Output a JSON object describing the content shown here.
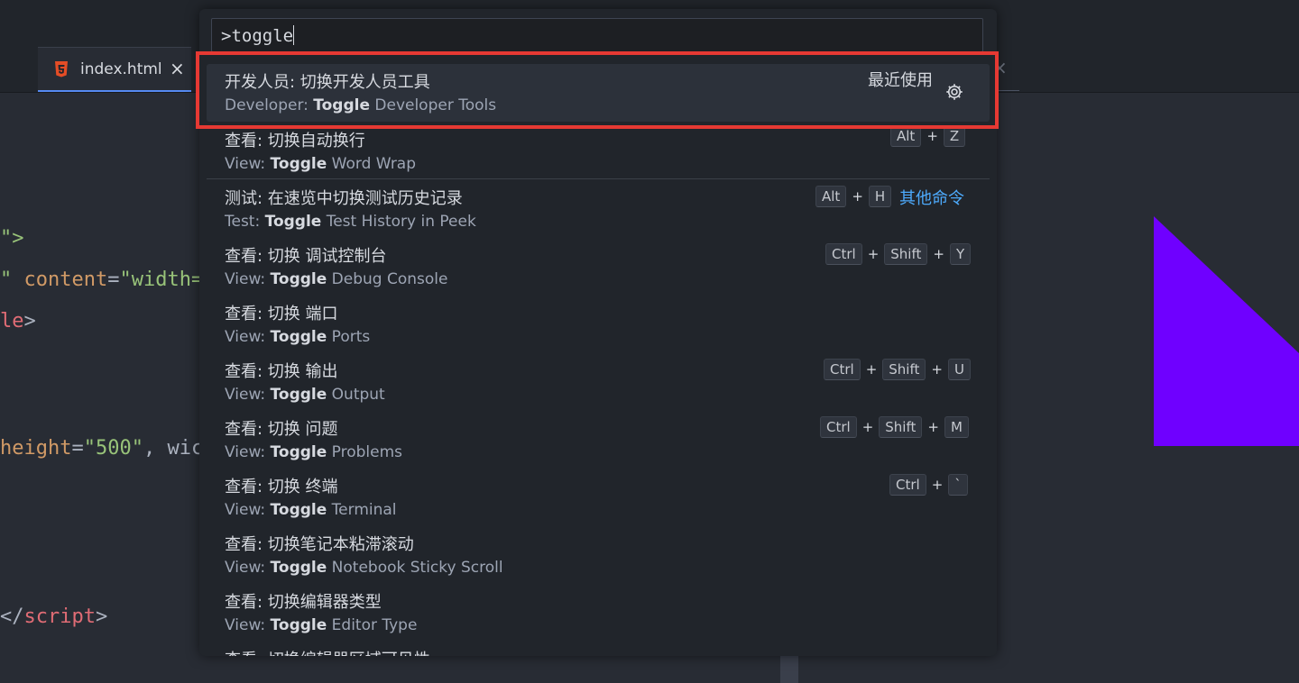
{
  "tab": {
    "label": "index.html",
    "close": "×"
  },
  "tab_bar_close": "×",
  "code_lines": {
    "l1": "\">",
    "l2_str": "\"",
    "l2_attr": " content",
    "l2_eq": "=",
    "l2_val": "\"width=",
    "l3_tag": "le",
    "l3_end": ">",
    "l4_attr": "height",
    "l4_eq": "=",
    "l4_val": "\"500\"",
    "l4_rest": ", wic",
    "l5_open": "</",
    "l5_tag": "script",
    "l5_end": ">"
  },
  "palette": {
    "query": ">toggle",
    "recently_used": "最近使用",
    "other_commands": "其他命令",
    "items": [
      {
        "label": "开发人员: 切换开发人员工具",
        "prefix": "Developer: ",
        "match": "Toggle",
        "suffix": " Developer Tools",
        "keys": []
      },
      {
        "label": "查看: 切换自动换行",
        "prefix": "View: ",
        "match": "Toggle",
        "suffix": " Word Wrap",
        "keys": [
          "Alt",
          "Z"
        ]
      },
      {
        "label": "测试: 在速览中切换测试历史记录",
        "prefix": "Test: ",
        "match": "Toggle",
        "suffix": " Test History in Peek",
        "keys": [
          "Alt",
          "H"
        ]
      },
      {
        "label": "查看: 切换 调试控制台",
        "prefix": "View: ",
        "match": "Toggle",
        "suffix": " Debug Console",
        "keys": [
          "Ctrl",
          "Shift",
          "Y"
        ]
      },
      {
        "label": "查看: 切换 端口",
        "prefix": "View: ",
        "match": "Toggle",
        "suffix": " Ports",
        "keys": []
      },
      {
        "label": "查看: 切换 输出",
        "prefix": "View: ",
        "match": "Toggle",
        "suffix": " Output",
        "keys": [
          "Ctrl",
          "Shift",
          "U"
        ]
      },
      {
        "label": "查看: 切换 问题",
        "prefix": "View: ",
        "match": "Toggle",
        "suffix": " Problems",
        "keys": [
          "Ctrl",
          "Shift",
          "M"
        ]
      },
      {
        "label": "查看: 切换 终端",
        "prefix": "View: ",
        "match": "Toggle",
        "suffix": " Terminal",
        "keys": [
          "Ctrl",
          "`"
        ]
      },
      {
        "label": "查看: 切换笔记本粘滞滚动",
        "prefix": "View: ",
        "match": "Toggle",
        "suffix": " Notebook Sticky Scroll",
        "keys": []
      },
      {
        "label": "查看: 切换编辑器类型",
        "prefix": "View: ",
        "match": "Toggle",
        "suffix": " Editor Type",
        "keys": []
      },
      {
        "label": "查看: 切换编辑器区域可见性",
        "prefix": "",
        "match": "",
        "suffix": "",
        "keys": []
      }
    ]
  },
  "colors": {
    "highlight_border": "#e63933",
    "accent_link": "#4daafc",
    "triangle": "#6f00ff"
  }
}
